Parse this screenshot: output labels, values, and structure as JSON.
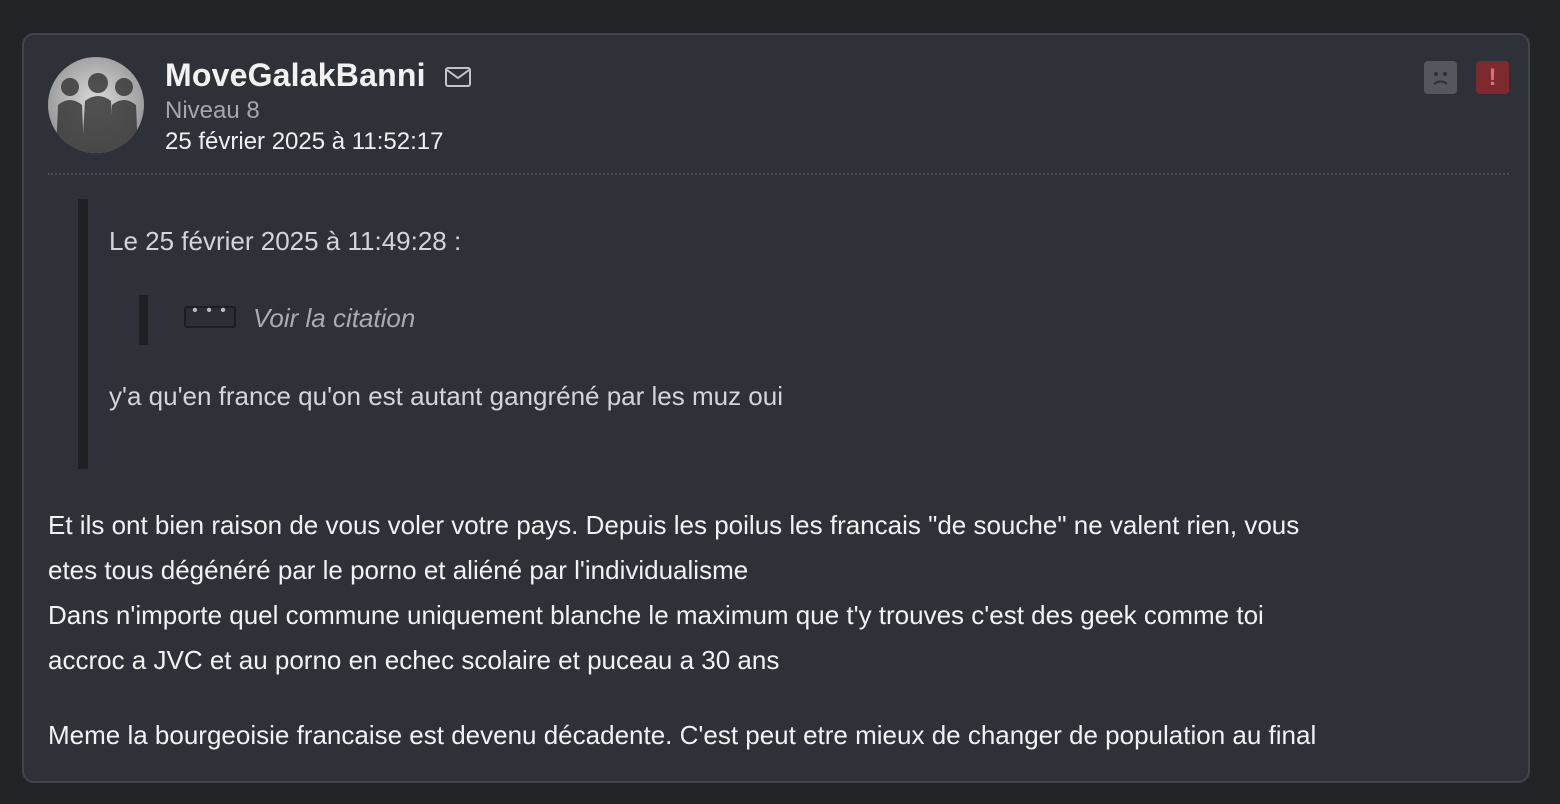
{
  "post": {
    "author": "MoveGalakBanni",
    "level": "Niveau 8",
    "date": "25 février 2025 à 11:52:17",
    "quote": {
      "header": "Le 25 février 2025 à 11:49:28 :",
      "expand_dots": "• • •",
      "show_quote": "Voir la citation",
      "text": "y'a qu'en france qu'on est autant gangréné par les muz oui"
    },
    "body_lines": [
      "Et ils ont bien raison de vous voler votre pays. Depuis les poilus les francais \"de souche\" ne valent rien, vous",
      "etes tous dégénéré par le porno et aliéné par l'individualisme",
      "Dans n'importe quel commune uniquement blanche le maximum que t'y trouves c'est des geek comme toi",
      "accroc a JVC et au porno en echec scolaire et puceau a 30 ans",
      "Meme la bourgeoisie francaise est devenu décadente. C'est peut etre mieux de changer de population au final"
    ]
  },
  "icons": {
    "avatar": "group-silhouette-avatar",
    "mail": "envelope-icon",
    "sad": "sad-face-icon",
    "alert": "exclamation-icon"
  },
  "colors": {
    "background": "#222428",
    "card": "#2e3138",
    "alert": "#7d2a2e"
  }
}
